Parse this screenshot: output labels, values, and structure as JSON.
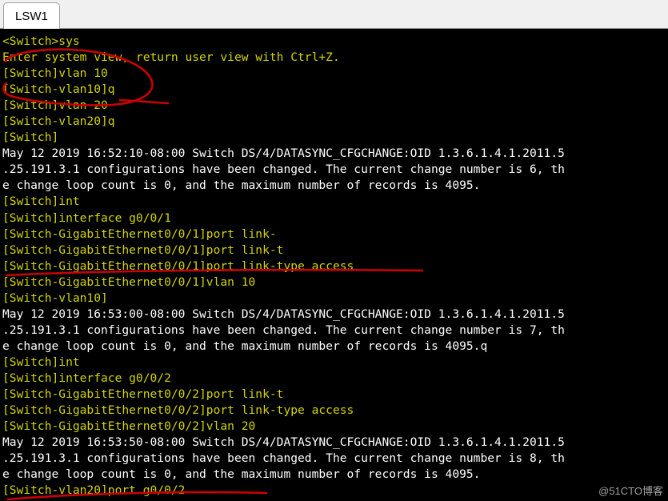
{
  "window": {
    "tabs": [
      {
        "label": "LSW1",
        "active": true
      }
    ]
  },
  "terminal": {
    "prompt_color": "#d4d400",
    "info_color": "#ffffff",
    "background": "#000000",
    "lines": [
      {
        "text": "<Switch>sys",
        "style": "prompt"
      },
      {
        "text": "Enter system view, return user view with Ctrl+Z.",
        "style": "prompt"
      },
      {
        "text": "[Switch]vlan 10",
        "style": "prompt"
      },
      {
        "text": "[Switch-vlan10]q",
        "style": "prompt"
      },
      {
        "text": "[Switch]vlan 20",
        "style": "prompt"
      },
      {
        "text": "[Switch-vlan20]q",
        "style": "prompt"
      },
      {
        "text": "[Switch]",
        "style": "prompt"
      },
      {
        "text": "May 12 2019 16:52:10-08:00 Switch DS/4/DATASYNC_CFGCHANGE:OID 1.3.6.1.4.1.2011.5",
        "style": "info"
      },
      {
        "text": ".25.191.3.1 configurations have been changed. The current change number is 6, th",
        "style": "info"
      },
      {
        "text": "e change loop count is 0, and the maximum number of records is 4095.",
        "style": "info"
      },
      {
        "text": "[Switch]int",
        "style": "prompt"
      },
      {
        "text": "[Switch]interface g0/0/1",
        "style": "prompt"
      },
      {
        "text": "[Switch-GigabitEthernet0/0/1]port link-",
        "style": "prompt"
      },
      {
        "text": "[Switch-GigabitEthernet0/0/1]port link-t",
        "style": "prompt"
      },
      {
        "text": "[Switch-GigabitEthernet0/0/1]port link-type access",
        "style": "prompt"
      },
      {
        "text": "[Switch-GigabitEthernet0/0/1]vlan 10",
        "style": "prompt"
      },
      {
        "text": "[Switch-vlan10]",
        "style": "prompt"
      },
      {
        "text": "May 12 2019 16:53:00-08:00 Switch DS/4/DATASYNC_CFGCHANGE:OID 1.3.6.1.4.1.2011.5",
        "style": "info"
      },
      {
        "text": ".25.191.3.1 configurations have been changed. The current change number is 7, th",
        "style": "info"
      },
      {
        "text": "e change loop count is 0, and the maximum number of records is 4095.q",
        "style": "info"
      },
      {
        "text": "[Switch]int",
        "style": "prompt"
      },
      {
        "text": "[Switch]interface g0/0/2",
        "style": "prompt"
      },
      {
        "text": "[Switch-GigabitEthernet0/0/2]port link-t",
        "style": "prompt"
      },
      {
        "text": "[Switch-GigabitEthernet0/0/2]port link-type access",
        "style": "prompt"
      },
      {
        "text": "[Switch-GigabitEthernet0/0/2]vlan 20",
        "style": "prompt"
      },
      {
        "text": "May 12 2019 16:53:50-08:00 Switch DS/4/DATASYNC_CFGCHANGE:OID 1.3.6.1.4.1.2011.5",
        "style": "info"
      },
      {
        "text": ".25.191.3.1 configurations have been changed. The current change number is 8, th",
        "style": "info"
      },
      {
        "text": "e change loop count is 0, and the maximum number of records is 4095.",
        "style": "info"
      },
      {
        "text": "[Switch-vlan20]port g0/0/2",
        "style": "prompt"
      }
    ]
  },
  "annotations": {
    "color": "#cc0000",
    "marks": [
      {
        "name": "circle-vlan-commands",
        "shape": "ellipse"
      },
      {
        "name": "underline-link-type-access-1",
        "shape": "line"
      },
      {
        "name": "underline-port-g0-0-2",
        "shape": "line"
      }
    ]
  },
  "watermark": {
    "text": "@51CTO博客"
  }
}
